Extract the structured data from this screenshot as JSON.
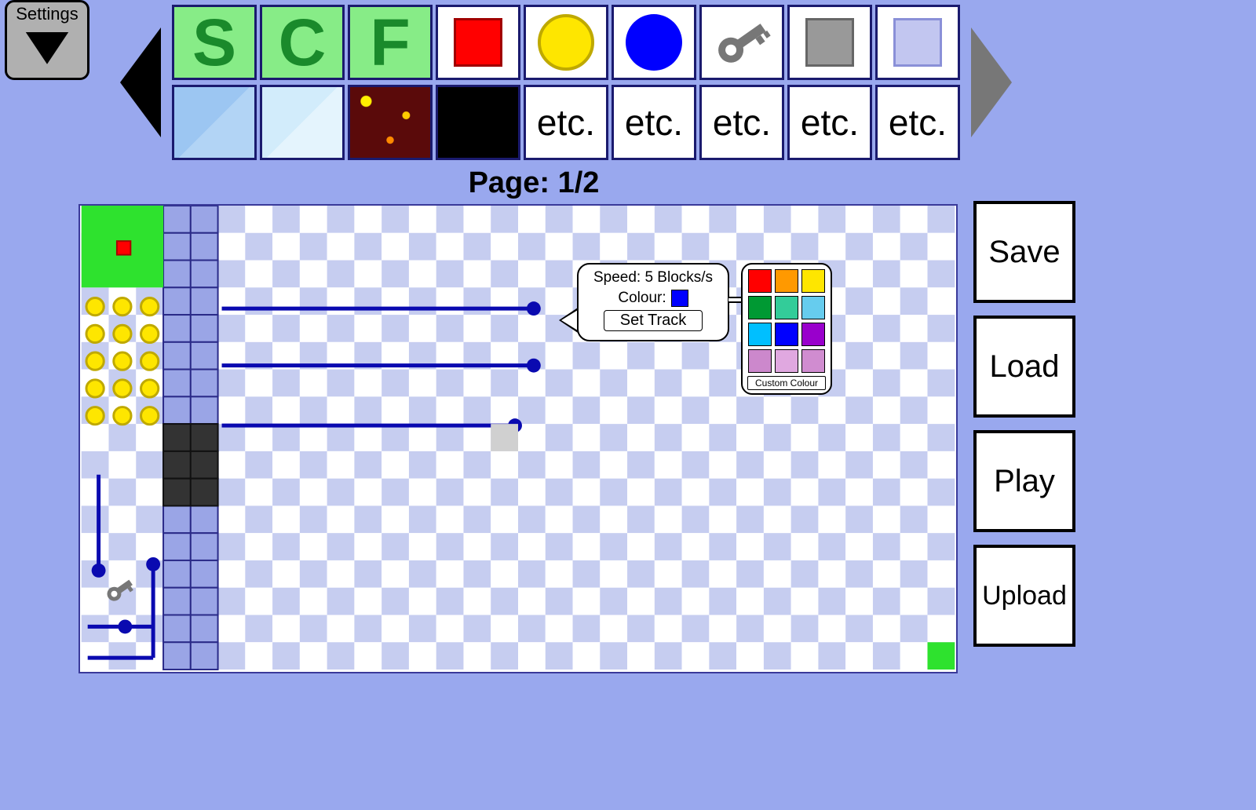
{
  "settings": {
    "label": "Settings"
  },
  "palette": {
    "page_label": "Page: 1/2",
    "row1": [
      "S",
      "C",
      "F",
      "red-square",
      "yellow-coin",
      "blue-circle",
      "key",
      "grey-square",
      "lavender-square"
    ],
    "row2": [
      "ltblue",
      "vlblue",
      "lava",
      "black",
      "etc.",
      "etc.",
      "etc.",
      "etc.",
      "etc."
    ]
  },
  "popup": {
    "speed_label": "Speed: 5 Blocks/s",
    "colour_label": "Colour:",
    "colour_value": "#0000ff",
    "set_track_label": "Set Track"
  },
  "colour_panel": {
    "colours": [
      "#ff0000",
      "#ff9900",
      "#fee600",
      "#009933",
      "#33cc99",
      "#66ccee",
      "#00bfff",
      "#0000ff",
      "#9900cc",
      "#cc88cc",
      "#e0a8e0",
      "#d08cd0"
    ],
    "custom_label": "Custom Colour"
  },
  "right_buttons": {
    "save": "Save",
    "load": "Load",
    "play": "Play",
    "upload": "Upload"
  },
  "editor": {
    "grid_cols": 32,
    "grid_rows": 17,
    "cell": 35
  }
}
